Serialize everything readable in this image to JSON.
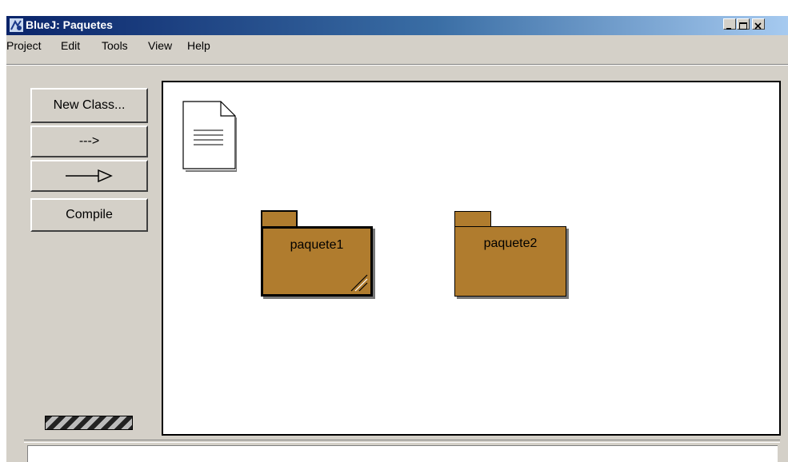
{
  "window": {
    "title": "BlueJ: Paquetes",
    "controls": {
      "minimize": "minimize",
      "maximize": "maximize",
      "close": "close"
    }
  },
  "menu": {
    "items": [
      {
        "label": "Project"
      },
      {
        "label": "Edit"
      },
      {
        "label": "Tools"
      },
      {
        "label": "View"
      },
      {
        "label": "Help"
      }
    ]
  },
  "toolbar": {
    "new_class_label": "New Class...",
    "dependency_arrow_label": "--->",
    "compile_label": "Compile"
  },
  "diagram": {
    "packages": [
      {
        "name": "paquete1",
        "selected": true
      },
      {
        "name": "paquete2",
        "selected": false
      }
    ],
    "package_color": "#b07c2e"
  },
  "status": {
    "message": ""
  }
}
